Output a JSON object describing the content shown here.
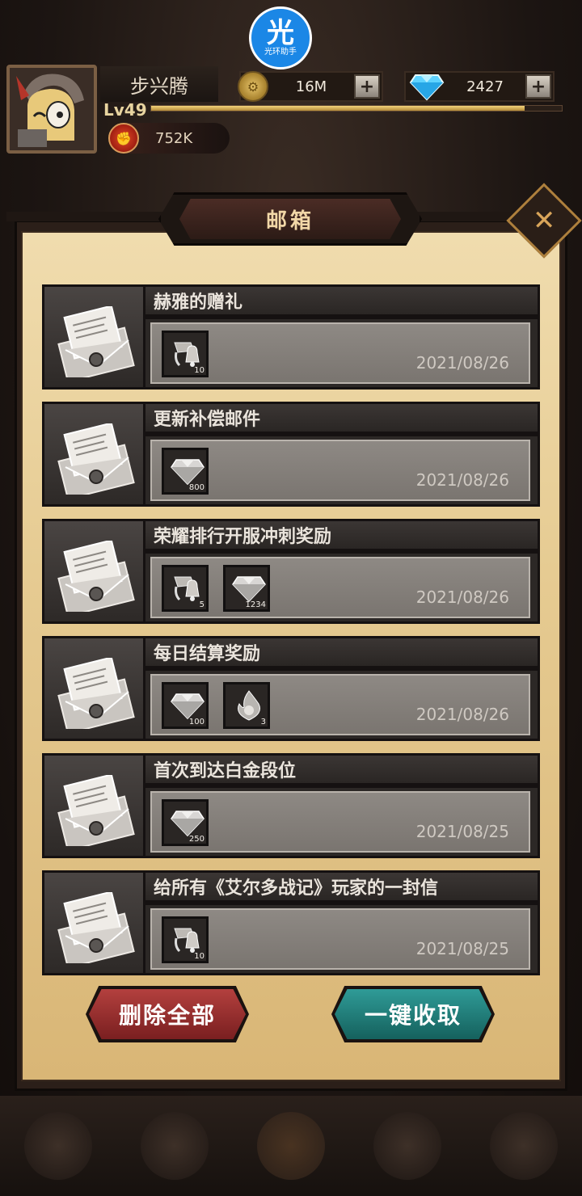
{
  "overlay_badge": {
    "glyph": "光",
    "label": "光环助手"
  },
  "player": {
    "name": "步兴腾",
    "level": "Lv49",
    "xp_fraction": 0.91,
    "power": "752K"
  },
  "resources": {
    "gold": {
      "icon": "coin-icon",
      "value": "16M"
    },
    "gems": {
      "icon": "diamond-icon",
      "value": "2427"
    }
  },
  "mailbox": {
    "title": "邮箱",
    "mails": [
      {
        "title": "赫雅的赠礼",
        "date": "2021/08/26",
        "items": [
          {
            "icon": "bell-scroll-icon",
            "count": "10"
          }
        ]
      },
      {
        "title": "更新补偿邮件",
        "date": "2021/08/26",
        "items": [
          {
            "icon": "diamond-icon",
            "count": "800"
          }
        ]
      },
      {
        "title": "荣耀排行开服冲刺奖励",
        "date": "2021/08/26",
        "items": [
          {
            "icon": "bell-scroll-icon",
            "count": "5"
          },
          {
            "icon": "diamond-icon",
            "count": "1234"
          }
        ]
      },
      {
        "title": "每日结算奖励",
        "date": "2021/08/26",
        "items": [
          {
            "icon": "diamond-icon",
            "count": "100"
          },
          {
            "icon": "flame-icon",
            "count": "3"
          }
        ]
      },
      {
        "title": "首次到达白金段位",
        "date": "2021/08/25",
        "items": [
          {
            "icon": "diamond-icon",
            "count": "250"
          }
        ]
      },
      {
        "title": "给所有《艾尔多战记》玩家的一封信",
        "date": "2021/08/25",
        "items": [
          {
            "icon": "bell-scroll-icon",
            "count": "10"
          }
        ]
      }
    ],
    "delete_all_label": "删除全部",
    "claim_all_label": "一键收取"
  },
  "colors": {
    "parchment": "#e6cb92",
    "delete_button": "#9a2d2d",
    "claim_button": "#237f7b",
    "gold_text": "#f1d7a7"
  }
}
